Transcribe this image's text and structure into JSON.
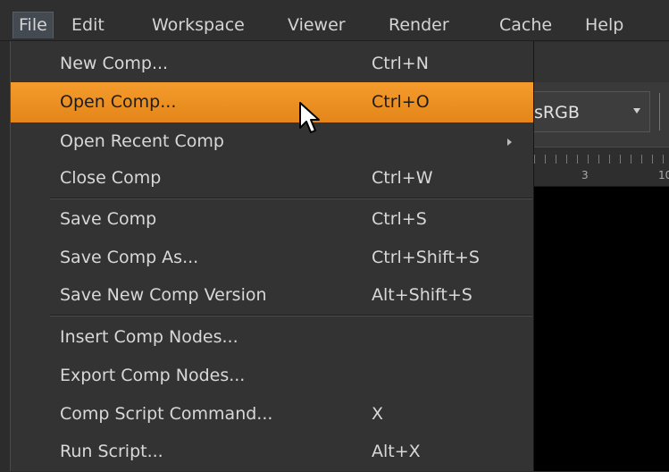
{
  "menubar": {
    "items": [
      {
        "label": "File",
        "active": true
      },
      {
        "label": "Edit"
      },
      {
        "label": "Workspace"
      },
      {
        "label": "Viewer"
      },
      {
        "label": "Render"
      },
      {
        "label": "Cache"
      },
      {
        "label": "Help"
      }
    ]
  },
  "file_menu": {
    "items": [
      {
        "label": "New Comp...",
        "shortcut": "Ctrl+N"
      },
      {
        "label": "Open Comp...",
        "shortcut": "Ctrl+O",
        "highlighted": true
      },
      {
        "label": "Open Recent Comp",
        "shortcut": "",
        "submenu": true
      },
      {
        "label": "Close Comp",
        "shortcut": "Ctrl+W"
      },
      {
        "label": "Save Comp",
        "shortcut": "Ctrl+S"
      },
      {
        "label": "Save Comp As...",
        "shortcut": "Ctrl+Shift+S"
      },
      {
        "label": "Save New Comp Version",
        "shortcut": "Alt+Shift+S"
      },
      {
        "label": "Insert Comp Nodes...",
        "shortcut": ""
      },
      {
        "label": "Export Comp Nodes...",
        "shortcut": ""
      },
      {
        "label": "Comp Script Command...",
        "shortcut": "X"
      },
      {
        "label": "Run Script...",
        "shortcut": "Alt+X"
      }
    ]
  },
  "viewer": {
    "colorspace": "sRGB",
    "ruler_labels": [
      "3",
      "10"
    ]
  },
  "colors": {
    "highlight": "#f0952a",
    "menu_bg": "#333333",
    "viewer_bg": "#000000"
  },
  "icons": {
    "cursor": "arrow-cursor-icon",
    "submenu": "submenu-arrow-icon",
    "dropdown": "dropdown-arrow-icon"
  }
}
